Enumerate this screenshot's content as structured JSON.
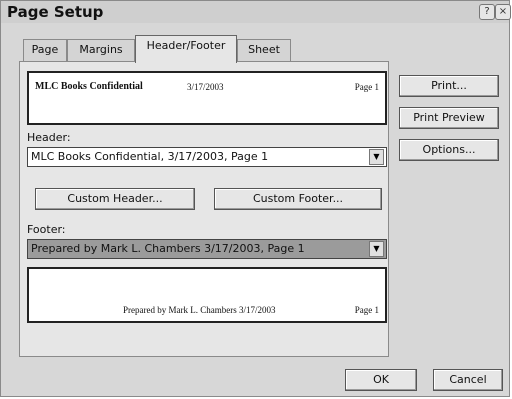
{
  "window": {
    "title": "Page Setup",
    "help_glyph": "?",
    "close_glyph": "×"
  },
  "tabs": [
    {
      "label": "Page"
    },
    {
      "label": "Margins"
    },
    {
      "label": "Header/Footer"
    },
    {
      "label": "Sheet"
    }
  ],
  "header_preview": {
    "left": "MLC Books Confidential",
    "date": "3/17/2003",
    "right": "Page 1"
  },
  "header_field": {
    "label": "Header:",
    "value": "MLC Books Confidential, 3/17/2003, Page 1"
  },
  "buttons": {
    "custom_header": "Custom Header...",
    "custom_footer": "Custom Footer...",
    "print": "Print...",
    "print_preview": "Print Preview",
    "options": "Options...",
    "ok": "OK",
    "cancel": "Cancel"
  },
  "footer_field": {
    "label": "Footer:",
    "value": "Prepared by Mark L. Chambers 3/17/2003, Page 1"
  },
  "footer_preview": {
    "center": "Prepared by Mark L. Chambers 3/17/2003",
    "right": "Page 1"
  },
  "dropdown_glyph": "▼"
}
